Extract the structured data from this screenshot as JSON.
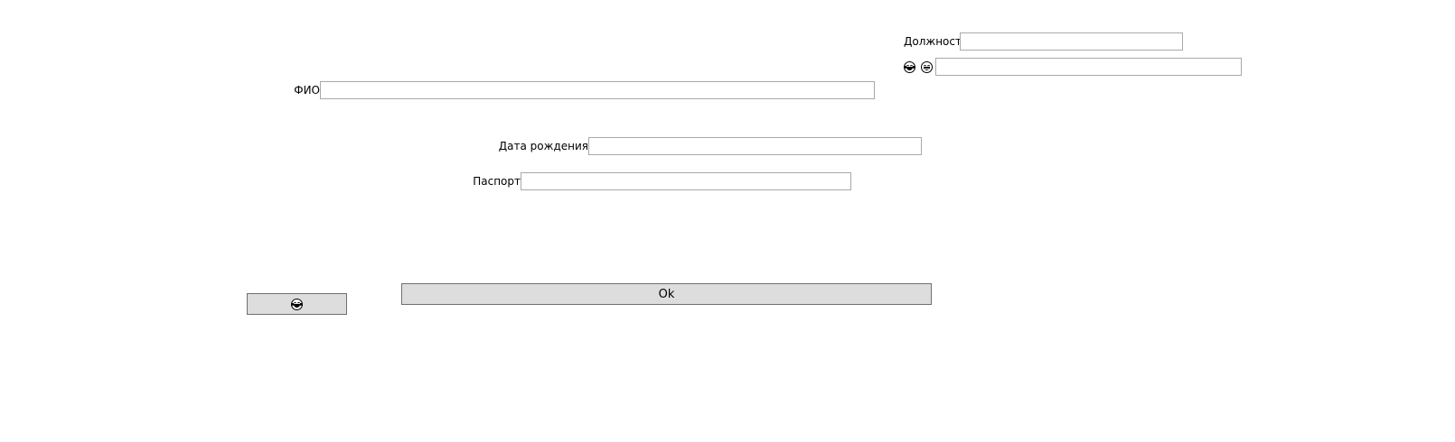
{
  "form": {
    "position_label": "Должность",
    "fio_label": "ФИО",
    "birthdate_label": "Дата рождения",
    "passport_label": "Паспорт",
    "position_value": "",
    "emoji_field_value": "",
    "fio_value": "",
    "birthdate_value": "",
    "passport_value": ""
  },
  "emoji_labels": {
    "first_icon": "face-with-tears-of-joy-icon",
    "second_icon": "grinning-face-icon"
  },
  "buttons": {
    "ok_label": "Ok",
    "emoji_button_icon": "face-with-tears-of-joy-icon"
  }
}
